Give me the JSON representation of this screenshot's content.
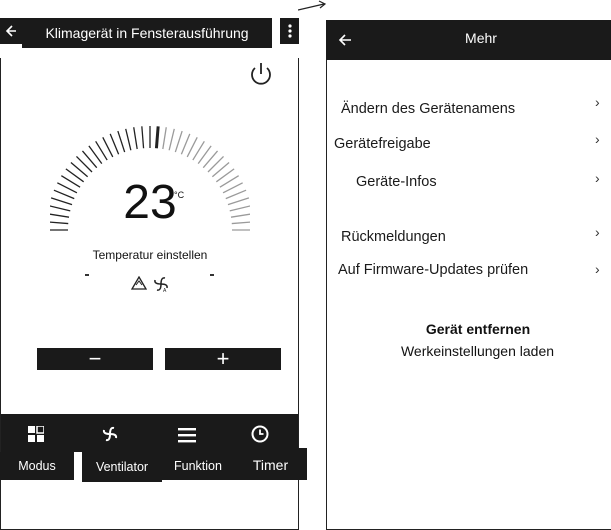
{
  "left_screen": {
    "title": "Klimagerät in Fensterausführung",
    "back_icon": "back-arrow-icon",
    "more_icon": "more-vertical-icon",
    "power_icon": "power-icon",
    "temperature": "23",
    "unit": "°C",
    "temperature_label": "Temperatur einstellen",
    "mode_icons": [
      "triangle-mode-icon",
      "fan-auto-icon"
    ],
    "minus_label": "−",
    "plus_label": "+",
    "tabs": [
      {
        "label": "Modus",
        "icon": "modus-icon"
      },
      {
        "label": "Ventilator",
        "icon": "fan-icon"
      },
      {
        "label": "Funktion",
        "icon": "menu-icon"
      },
      {
        "label": "Timer",
        "icon": "clock-icon"
      }
    ]
  },
  "right_screen": {
    "title": "Mehr",
    "back_icon": "back-arrow-icon",
    "menu_items": [
      {
        "label": "Ändern des Gerätenamens"
      },
      {
        "label": "Gerätefreigabe"
      },
      {
        "label": "Geräte-Infos"
      },
      {
        "label": "Rückmeldungen"
      },
      {
        "label": "Auf Firmware-Updates prüfen"
      }
    ],
    "remove_label": "Gerät entfernen",
    "reset_label": "Werkeinstellungen laden",
    "chevron": "›"
  },
  "connector_icon": "arrow-right-icon"
}
